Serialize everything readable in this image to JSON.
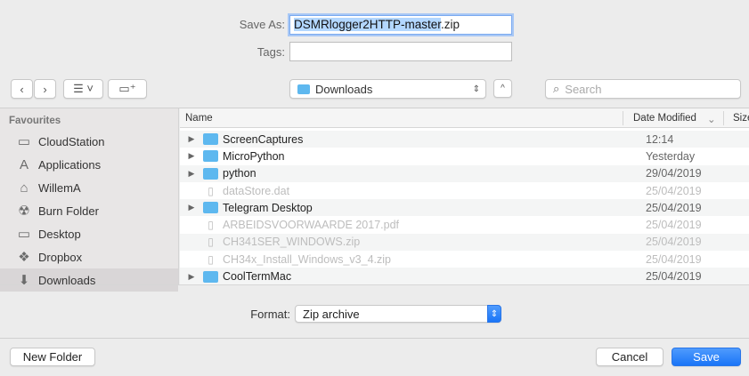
{
  "save_as": {
    "label": "Save As:",
    "value_selected": "DSMRlogger2HTTP-master",
    "value_ext": ".zip"
  },
  "tags": {
    "label": "Tags:",
    "value": ""
  },
  "toolbar": {
    "location": "Downloads",
    "search_placeholder": "Search"
  },
  "sidebar": {
    "heading": "Favourites",
    "items": [
      {
        "label": "CloudStation",
        "icon": "folder-icon"
      },
      {
        "label": "Applications",
        "icon": "applications-icon"
      },
      {
        "label": "WillemA",
        "icon": "home-icon"
      },
      {
        "label": "Burn Folder",
        "icon": "burn-icon"
      },
      {
        "label": "Desktop",
        "icon": "desktop-icon"
      },
      {
        "label": "Dropbox",
        "icon": "dropbox-icon"
      },
      {
        "label": "Downloads",
        "icon": "download-icon"
      }
    ]
  },
  "columns": {
    "name": "Name",
    "date": "Date Modified",
    "size": "Size"
  },
  "files": [
    {
      "name": "ScreenCaptures",
      "date": "12:14",
      "type": "folder"
    },
    {
      "name": "MicroPython",
      "date": "Yesterday",
      "type": "folder"
    },
    {
      "name": "python",
      "date": "29/04/2019",
      "type": "folder"
    },
    {
      "name": "dataStore.dat",
      "date": "25/04/2019",
      "type": "file"
    },
    {
      "name": "Telegram Desktop",
      "date": "25/04/2019",
      "type": "folder"
    },
    {
      "name": "ARBEIDSVOORWAARDE  2017.pdf",
      "date": "25/04/2019",
      "type": "file"
    },
    {
      "name": "CH341SER_WINDOWS.zip",
      "date": "25/04/2019",
      "type": "file"
    },
    {
      "name": "CH34x_Install_Windows_v3_4.zip",
      "date": "25/04/2019",
      "type": "file"
    },
    {
      "name": "CoolTermMac",
      "date": "25/04/2019",
      "type": "folder"
    }
  ],
  "format": {
    "label": "Format:",
    "value": "Zip archive"
  },
  "buttons": {
    "new_folder": "New Folder",
    "cancel": "Cancel",
    "save": "Save"
  }
}
